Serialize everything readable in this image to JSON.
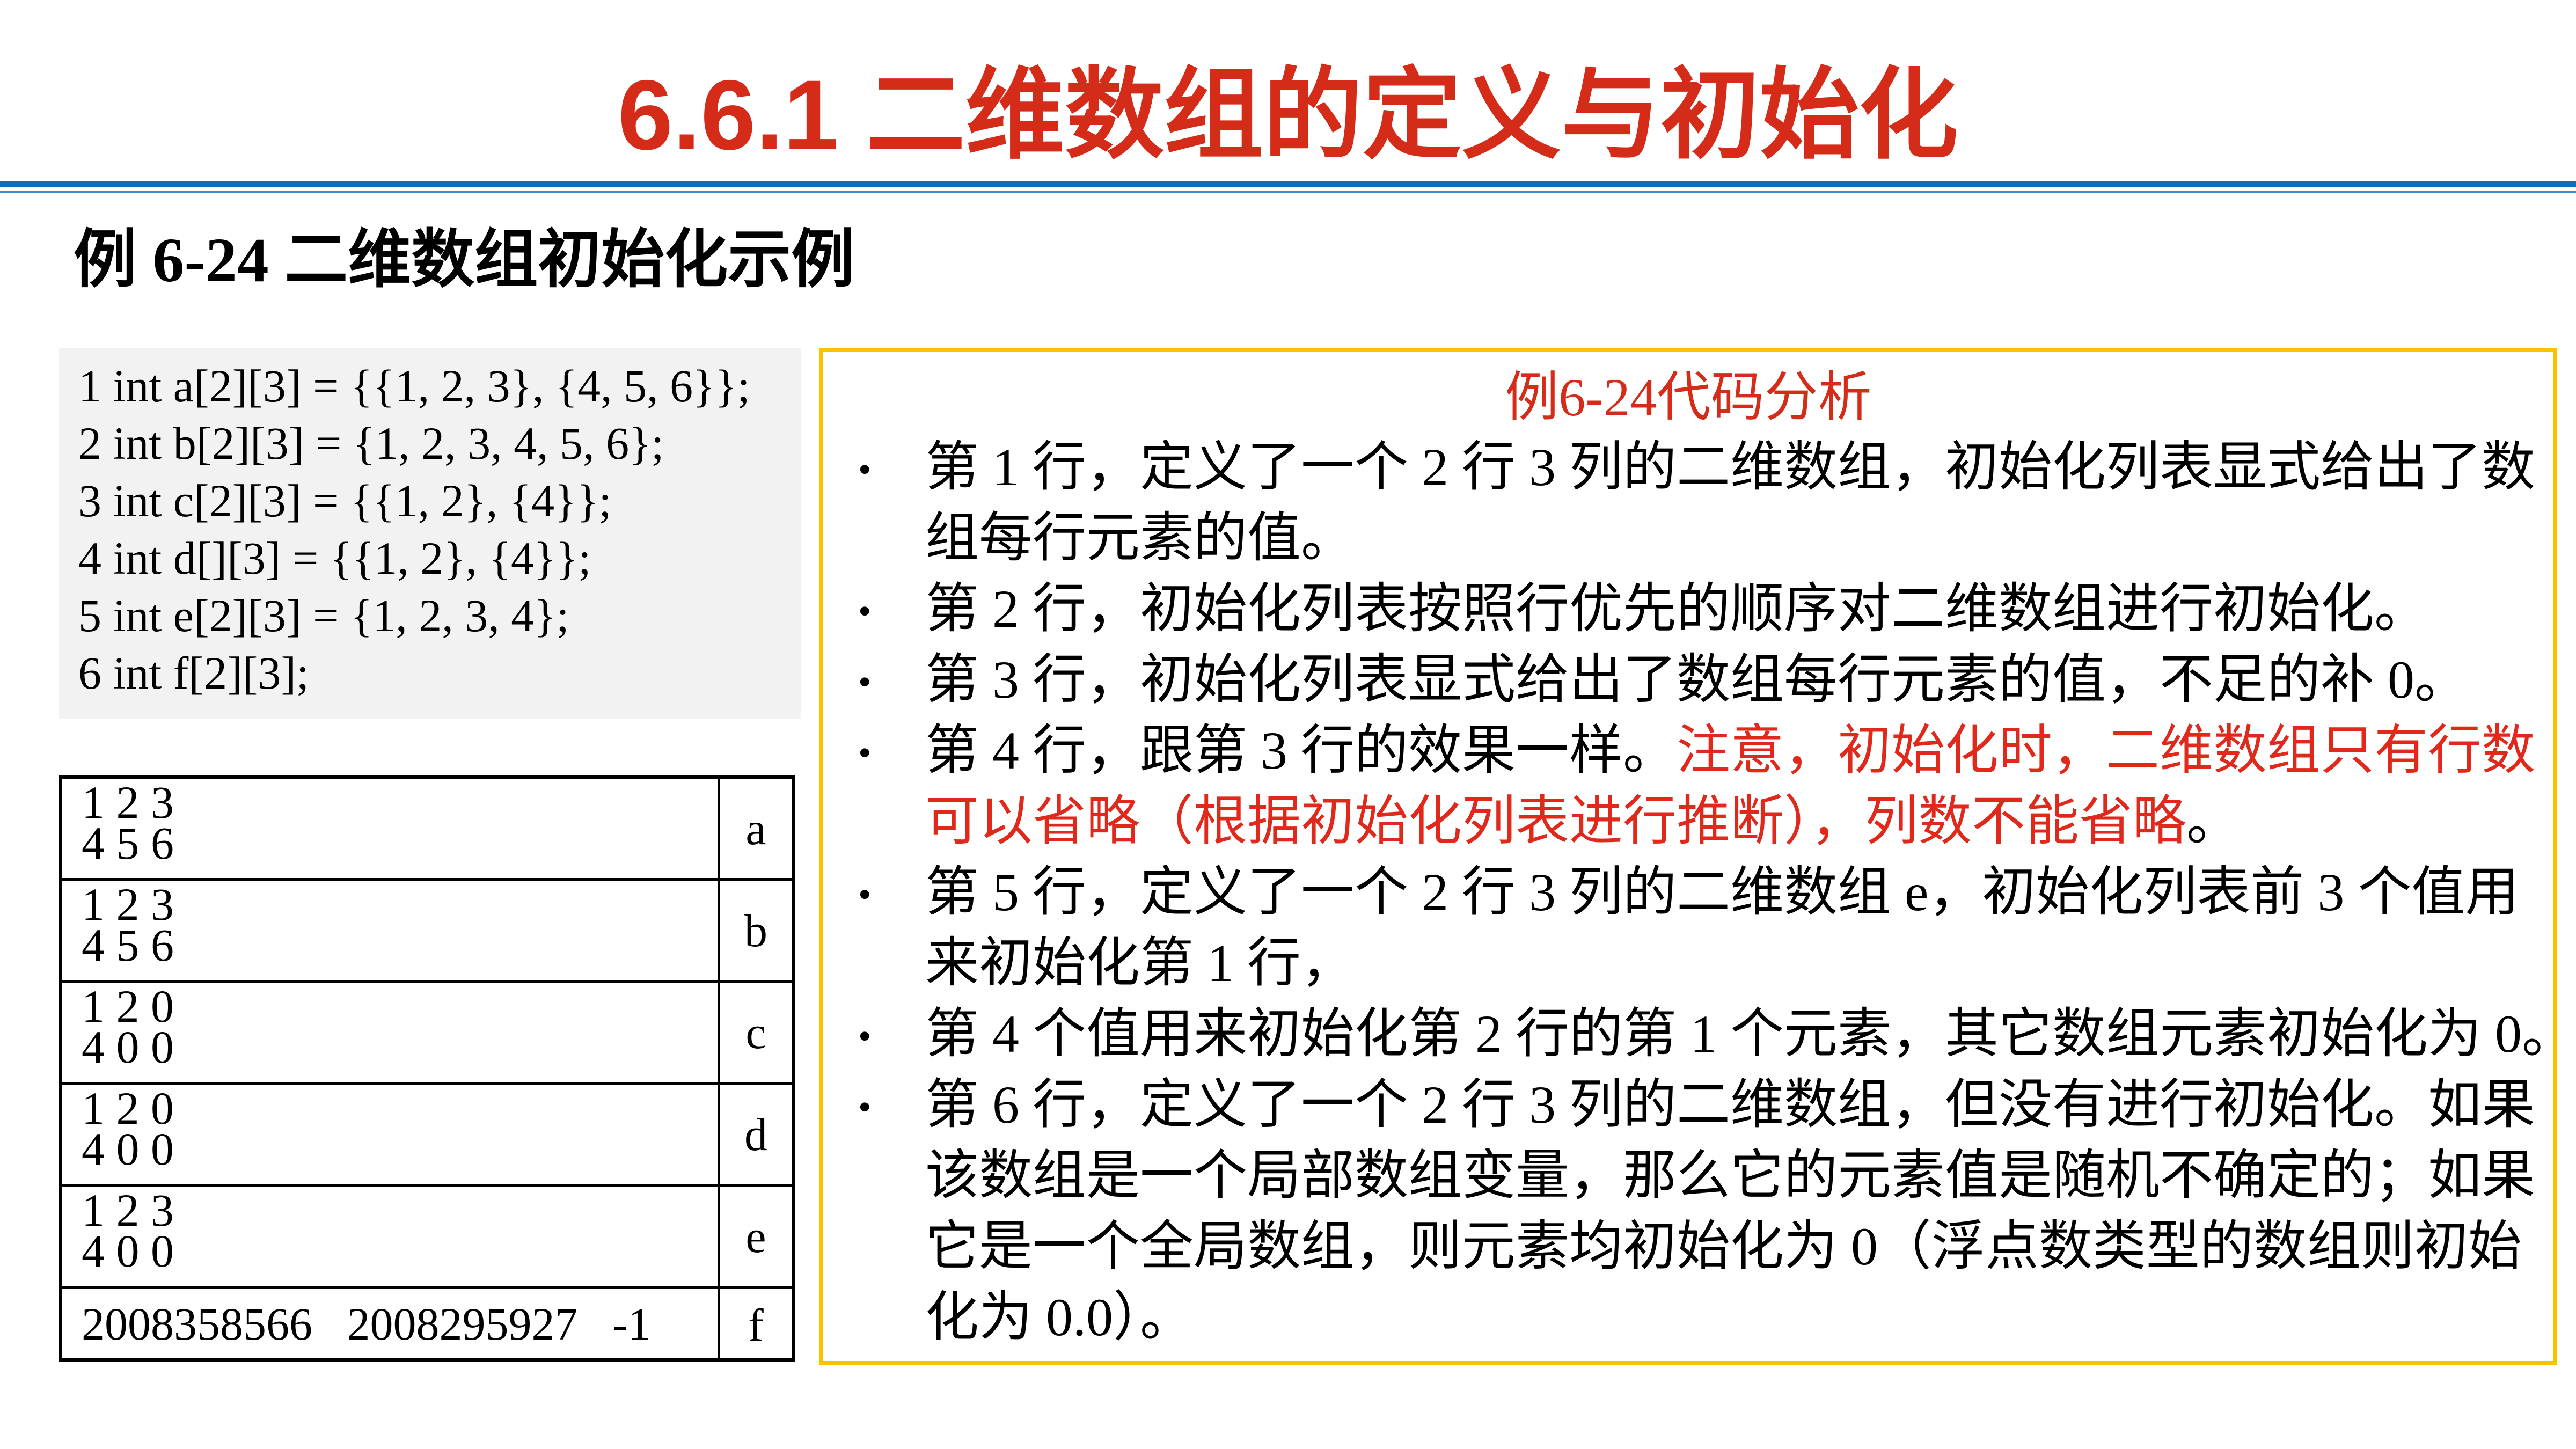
{
  "title": "6.6.1 二维数组的定义与初始化",
  "subtitle": "例 6-24 二维数组初始化示例",
  "code_lines": [
    "1 int a[2][3] = {{1, 2, 3}, {4, 5, 6}};",
    "2 int b[2][3] = {1, 2, 3, 4, 5, 6};",
    "3 int c[2][3] = {{1, 2}, {4}};",
    "4 int d[][3] = {{1, 2}, {4}};",
    "5 int e[2][3] = {1, 2, 3, 4};",
    "6 int f[2][3];"
  ],
  "output_rows": [
    {
      "values": "1 2 3\n4 5 6",
      "name": "a"
    },
    {
      "values": "1 2 3\n4 5 6",
      "name": "b"
    },
    {
      "values": "1 2 0\n4 0 0",
      "name": "c"
    },
    {
      "values": "1 2 0\n4 0 0",
      "name": "d"
    },
    {
      "values": "1 2 3\n4 0 0",
      "name": "e"
    },
    {
      "values": "2008358566   2008295927   -1",
      "name": "f"
    }
  ],
  "analysis": {
    "title": "例6-24代码分析",
    "bullet_symbol": "•",
    "bullets": [
      {
        "lines": [
          [
            {
              "t": "第 1 行，定义了一个 2 行 3 列的二维数组，初始化列表显式给出了数"
            }
          ],
          [
            {
              "t": "组每行元素的值。"
            }
          ]
        ]
      },
      {
        "lines": [
          [
            {
              "t": "第 2 行，初始化列表按照行优先的顺序对二维数组进行初始化。"
            }
          ]
        ]
      },
      {
        "lines": [
          [
            {
              "t": "第 3 行，初始化列表显式给出了数组每行元素的值，不足的补 0。"
            }
          ]
        ]
      },
      {
        "lines": [
          [
            {
              "t": "第 4 行，跟第 3 行的效果一样。"
            },
            {
              "t": "注意，初始化时，二维数组只有行数",
              "red": true
            }
          ],
          [
            {
              "t": "可以省略（根据初始化列表进行推断），列数不能省略",
              "red": true
            },
            {
              "t": "。"
            }
          ]
        ]
      },
      {
        "lines": [
          [
            {
              "t": "第 5 行，定义了一个 2 行 3 列的二维数组 e，初始化列表前 3 个值用"
            }
          ],
          [
            {
              "t": "来初始化第 1 行，"
            }
          ]
        ]
      },
      {
        "lines": [
          [
            {
              "t": "第 4 个值用来初始化第 2 行的第 1 个元素，其它数组元素初始化为 0。"
            }
          ]
        ]
      },
      {
        "lines": [
          [
            {
              "t": "第 6 行，定义了一个 2 行 3 列的二维数组，但没有进行初始化。如果"
            }
          ],
          [
            {
              "t": "该数组是一个局部数组变量，那么它的元素值是随机不确定的；如果"
            }
          ],
          [
            {
              "t": "它是一个全局数组，则元素均初始化为 0（浮点数类型的数组则初始"
            }
          ],
          [
            {
              "t": "化为 0.0）。"
            }
          ]
        ]
      }
    ]
  },
  "colors": {
    "title": "#d42c19",
    "rule": "#0a6fc2",
    "box_border": "#ffc000",
    "code_bg": "#f2f2f2",
    "highlight": "#e0281b"
  }
}
